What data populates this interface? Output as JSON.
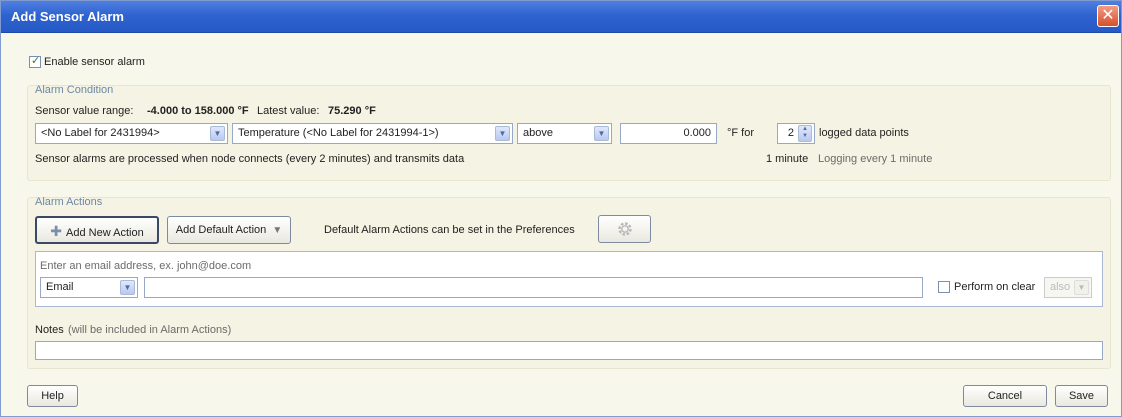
{
  "window": {
    "title": "Add Sensor Alarm",
    "close_glyph": "✕"
  },
  "enable_alarm": {
    "label": "Enable sensor alarm",
    "checked": true
  },
  "alarm_condition": {
    "title": "Alarm Condition",
    "range_prefix": "Sensor value range:",
    "range_value": "-4.000 to 158.000 °F",
    "latest_prefix": "Latest value:",
    "latest_value": "75.290 °F",
    "sensor_select": "<No Label for 2431994>",
    "measurement_select": "Temperature (<No Label for 2431994-1>)",
    "comparison_select": "above",
    "threshold_value": "0.000",
    "unit_for": "°F for",
    "points_count": "2",
    "points_label": "logged data points",
    "processing_note": "Sensor alarms are processed when node connects  (every 2 minutes) and transmits data",
    "duration": "1 minute",
    "logging_note": "Logging every  1 minute"
  },
  "alarm_actions": {
    "title": "Alarm Actions",
    "add_new_label": "Add New Action",
    "add_default_label": "Add Default Action",
    "preferences_note": "Default Alarm Actions can be set in the Preferences",
    "email_hint": "Enter an email address, ex. john@doe.com",
    "action_type": "Email",
    "email_value": "",
    "perform_on_clear_label": "Perform on clear",
    "perform_on_clear_checked": false,
    "clear_mode": "also"
  },
  "notes": {
    "label": "Notes",
    "hint": "(will be included in Alarm Actions)",
    "value": ""
  },
  "footer": {
    "help_label": "Help",
    "cancel_label": "Cancel",
    "save_label": "Save"
  },
  "icons": {
    "add": "plus-icon",
    "dropdown": "triangle-down-icon",
    "settings": "gear-icon",
    "close": "close-icon"
  }
}
